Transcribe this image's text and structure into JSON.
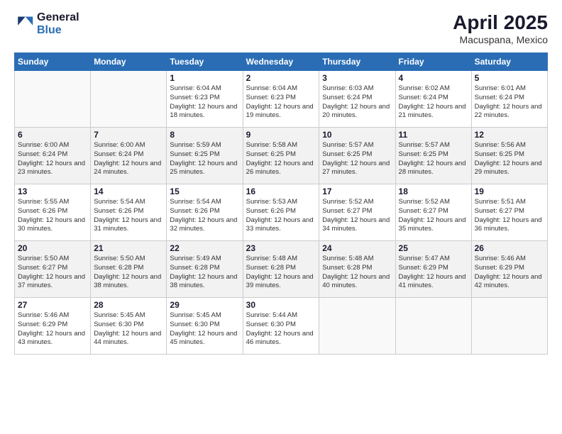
{
  "logo": {
    "general": "General",
    "blue": "Blue"
  },
  "title": "April 2025",
  "subtitle": "Macuspana, Mexico",
  "days_of_week": [
    "Sunday",
    "Monday",
    "Tuesday",
    "Wednesday",
    "Thursday",
    "Friday",
    "Saturday"
  ],
  "weeks": [
    [
      {
        "day": "",
        "sunrise": "",
        "sunset": "",
        "daylight": ""
      },
      {
        "day": "",
        "sunrise": "",
        "sunset": "",
        "daylight": ""
      },
      {
        "day": "1",
        "sunrise": "Sunrise: 6:04 AM",
        "sunset": "Sunset: 6:23 PM",
        "daylight": "Daylight: 12 hours and 18 minutes."
      },
      {
        "day": "2",
        "sunrise": "Sunrise: 6:04 AM",
        "sunset": "Sunset: 6:23 PM",
        "daylight": "Daylight: 12 hours and 19 minutes."
      },
      {
        "day": "3",
        "sunrise": "Sunrise: 6:03 AM",
        "sunset": "Sunset: 6:24 PM",
        "daylight": "Daylight: 12 hours and 20 minutes."
      },
      {
        "day": "4",
        "sunrise": "Sunrise: 6:02 AM",
        "sunset": "Sunset: 6:24 PM",
        "daylight": "Daylight: 12 hours and 21 minutes."
      },
      {
        "day": "5",
        "sunrise": "Sunrise: 6:01 AM",
        "sunset": "Sunset: 6:24 PM",
        "daylight": "Daylight: 12 hours and 22 minutes."
      }
    ],
    [
      {
        "day": "6",
        "sunrise": "Sunrise: 6:00 AM",
        "sunset": "Sunset: 6:24 PM",
        "daylight": "Daylight: 12 hours and 23 minutes."
      },
      {
        "day": "7",
        "sunrise": "Sunrise: 6:00 AM",
        "sunset": "Sunset: 6:24 PM",
        "daylight": "Daylight: 12 hours and 24 minutes."
      },
      {
        "day": "8",
        "sunrise": "Sunrise: 5:59 AM",
        "sunset": "Sunset: 6:25 PM",
        "daylight": "Daylight: 12 hours and 25 minutes."
      },
      {
        "day": "9",
        "sunrise": "Sunrise: 5:58 AM",
        "sunset": "Sunset: 6:25 PM",
        "daylight": "Daylight: 12 hours and 26 minutes."
      },
      {
        "day": "10",
        "sunrise": "Sunrise: 5:57 AM",
        "sunset": "Sunset: 6:25 PM",
        "daylight": "Daylight: 12 hours and 27 minutes."
      },
      {
        "day": "11",
        "sunrise": "Sunrise: 5:57 AM",
        "sunset": "Sunset: 6:25 PM",
        "daylight": "Daylight: 12 hours and 28 minutes."
      },
      {
        "day": "12",
        "sunrise": "Sunrise: 5:56 AM",
        "sunset": "Sunset: 6:25 PM",
        "daylight": "Daylight: 12 hours and 29 minutes."
      }
    ],
    [
      {
        "day": "13",
        "sunrise": "Sunrise: 5:55 AM",
        "sunset": "Sunset: 6:26 PM",
        "daylight": "Daylight: 12 hours and 30 minutes."
      },
      {
        "day": "14",
        "sunrise": "Sunrise: 5:54 AM",
        "sunset": "Sunset: 6:26 PM",
        "daylight": "Daylight: 12 hours and 31 minutes."
      },
      {
        "day": "15",
        "sunrise": "Sunrise: 5:54 AM",
        "sunset": "Sunset: 6:26 PM",
        "daylight": "Daylight: 12 hours and 32 minutes."
      },
      {
        "day": "16",
        "sunrise": "Sunrise: 5:53 AM",
        "sunset": "Sunset: 6:26 PM",
        "daylight": "Daylight: 12 hours and 33 minutes."
      },
      {
        "day": "17",
        "sunrise": "Sunrise: 5:52 AM",
        "sunset": "Sunset: 6:27 PM",
        "daylight": "Daylight: 12 hours and 34 minutes."
      },
      {
        "day": "18",
        "sunrise": "Sunrise: 5:52 AM",
        "sunset": "Sunset: 6:27 PM",
        "daylight": "Daylight: 12 hours and 35 minutes."
      },
      {
        "day": "19",
        "sunrise": "Sunrise: 5:51 AM",
        "sunset": "Sunset: 6:27 PM",
        "daylight": "Daylight: 12 hours and 36 minutes."
      }
    ],
    [
      {
        "day": "20",
        "sunrise": "Sunrise: 5:50 AM",
        "sunset": "Sunset: 6:27 PM",
        "daylight": "Daylight: 12 hours and 37 minutes."
      },
      {
        "day": "21",
        "sunrise": "Sunrise: 5:50 AM",
        "sunset": "Sunset: 6:28 PM",
        "daylight": "Daylight: 12 hours and 38 minutes."
      },
      {
        "day": "22",
        "sunrise": "Sunrise: 5:49 AM",
        "sunset": "Sunset: 6:28 PM",
        "daylight": "Daylight: 12 hours and 38 minutes."
      },
      {
        "day": "23",
        "sunrise": "Sunrise: 5:48 AM",
        "sunset": "Sunset: 6:28 PM",
        "daylight": "Daylight: 12 hours and 39 minutes."
      },
      {
        "day": "24",
        "sunrise": "Sunrise: 5:48 AM",
        "sunset": "Sunset: 6:28 PM",
        "daylight": "Daylight: 12 hours and 40 minutes."
      },
      {
        "day": "25",
        "sunrise": "Sunrise: 5:47 AM",
        "sunset": "Sunset: 6:29 PM",
        "daylight": "Daylight: 12 hours and 41 minutes."
      },
      {
        "day": "26",
        "sunrise": "Sunrise: 5:46 AM",
        "sunset": "Sunset: 6:29 PM",
        "daylight": "Daylight: 12 hours and 42 minutes."
      }
    ],
    [
      {
        "day": "27",
        "sunrise": "Sunrise: 5:46 AM",
        "sunset": "Sunset: 6:29 PM",
        "daylight": "Daylight: 12 hours and 43 minutes."
      },
      {
        "day": "28",
        "sunrise": "Sunrise: 5:45 AM",
        "sunset": "Sunset: 6:30 PM",
        "daylight": "Daylight: 12 hours and 44 minutes."
      },
      {
        "day": "29",
        "sunrise": "Sunrise: 5:45 AM",
        "sunset": "Sunset: 6:30 PM",
        "daylight": "Daylight: 12 hours and 45 minutes."
      },
      {
        "day": "30",
        "sunrise": "Sunrise: 5:44 AM",
        "sunset": "Sunset: 6:30 PM",
        "daylight": "Daylight: 12 hours and 46 minutes."
      },
      {
        "day": "",
        "sunrise": "",
        "sunset": "",
        "daylight": ""
      },
      {
        "day": "",
        "sunrise": "",
        "sunset": "",
        "daylight": ""
      },
      {
        "day": "",
        "sunrise": "",
        "sunset": "",
        "daylight": ""
      }
    ]
  ]
}
